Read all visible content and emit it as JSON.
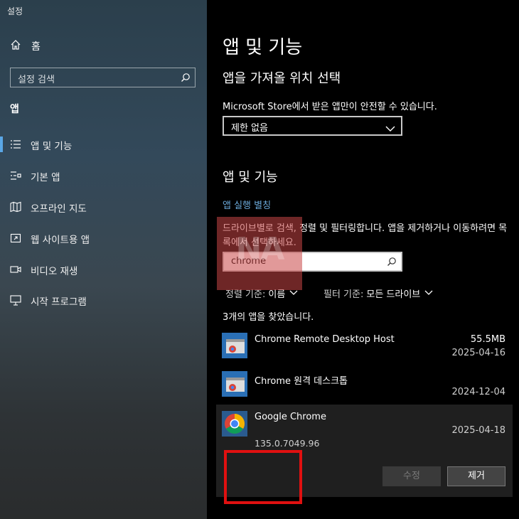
{
  "window": {
    "title": "설정"
  },
  "sidebar": {
    "home_label": "홈",
    "search_placeholder": "설정 검색",
    "section_title": "앱",
    "items": [
      {
        "label": "앱 및 기능",
        "icon": "list-icon",
        "active": true
      },
      {
        "label": "기본 앱",
        "icon": "default-apps-icon"
      },
      {
        "label": "오프라인 지도",
        "icon": "map-icon"
      },
      {
        "label": "웹 사이트용 앱",
        "icon": "website-app-icon"
      },
      {
        "label": "비디오 재생",
        "icon": "video-icon"
      },
      {
        "label": "시작 프로그램",
        "icon": "startup-icon"
      }
    ]
  },
  "main": {
    "title": "앱 및 기능",
    "install_section_title": "앱을 가져올 위치 선택",
    "install_desc": "Microsoft Store에서 받은 앱만이 안전할 수 있습니다.",
    "install_select_value": "제한 없음",
    "apps_section_title": "앱 및 기능",
    "aliases_link": "앱 실행 별칭",
    "search_desc": "드라이브별로 검색, 정렬 및 필터링합니다. 앱을 제거하거나 이동하려면 목록에서 선택하세요.",
    "search_value": "chrome",
    "sort_label": "정렬 기준:",
    "sort_value": "이름",
    "filter_label": "필터 기준:",
    "filter_value": "모든 드라이브",
    "result_count": "3개의 앱을 찾았습니다.",
    "apps": [
      {
        "name": "Chrome Remote Desktop Host",
        "size": "55.5MB",
        "date": "2025-04-16"
      },
      {
        "name": "Chrome 원격 데스크톱",
        "size": "",
        "date": "2024-12-04"
      },
      {
        "name": "Google Chrome",
        "size": "",
        "date": "2025-04-18",
        "version": "135.0.7049.96",
        "selected": true
      }
    ],
    "modify_button": "수정",
    "remove_button": "제거"
  },
  "watermark": {
    "text": "NA"
  },
  "colors": {
    "accent": "#5aa7e6",
    "highlight": "#e01010",
    "link": "#6aa8d8"
  }
}
